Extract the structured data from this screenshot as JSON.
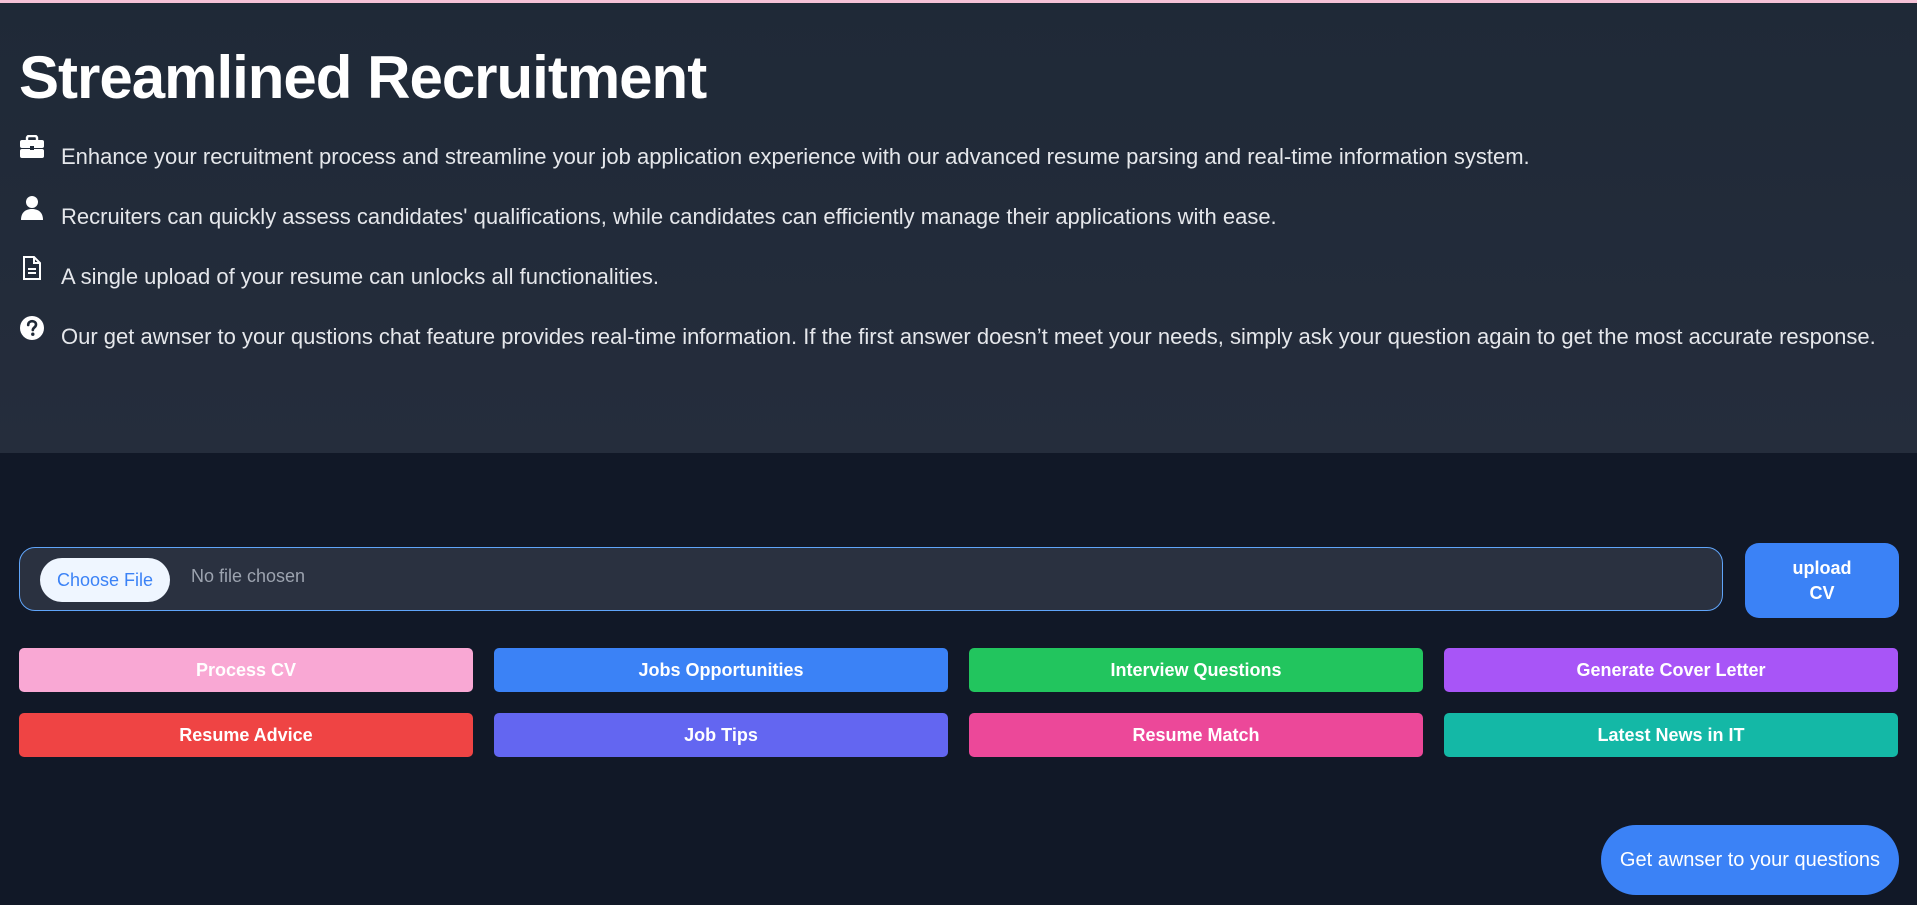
{
  "hero": {
    "title": "Streamlined Recruitment",
    "features": [
      {
        "icon": "briefcase-icon",
        "text": "Enhance your recruitment process and streamline your job application experience with our advanced resume parsing and real-time information system."
      },
      {
        "icon": "user-icon",
        "text": "Recruiters can quickly assess candidates' qualifications, while candidates can efficiently manage their applications with ease."
      },
      {
        "icon": "document-icon",
        "text": "A single upload of your resume can unlocks all functionalities."
      },
      {
        "icon": "question-circle-icon",
        "text": "Our get awnser to your qustions chat feature provides real-time information. If the first answer doesn’t meet your needs, simply ask your question again to get the most accurate response."
      }
    ]
  },
  "upload": {
    "choose_label": "Choose File",
    "status": "No file chosen",
    "upload_label": "upload CV"
  },
  "actions": [
    {
      "label": "Process CV",
      "color": "#f9a8d4"
    },
    {
      "label": "Jobs Opportunities",
      "color": "#3b82f6"
    },
    {
      "label": "Interview Questions",
      "color": "#22c55e"
    },
    {
      "label": "Generate Cover Letter",
      "color": "#a855f7"
    },
    {
      "label": "Resume Advice",
      "color": "#ef4444"
    },
    {
      "label": "Job Tips",
      "color": "#6366f1"
    },
    {
      "label": "Resume Match",
      "color": "#ec4899"
    },
    {
      "label": "Latest News in IT",
      "color": "#14b8a6"
    }
  ],
  "chat": {
    "ask_label": "Get awnser to your questions"
  },
  "colors": {
    "background": "#111827",
    "hero_background": "#1f2937",
    "accent": "#3b82f6"
  }
}
